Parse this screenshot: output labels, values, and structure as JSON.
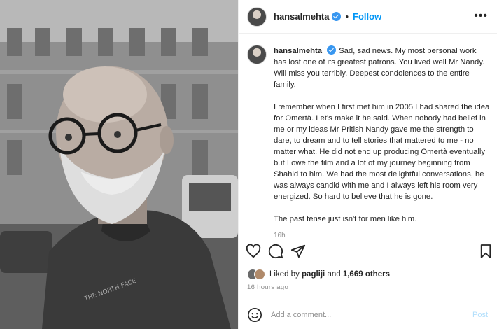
{
  "post": {
    "username": "hansalmehta",
    "dot": "•",
    "follow_label": "Follow",
    "more_label": "•••",
    "caption": {
      "username": "hansalmehta",
      "p1": "Sad, sad news. My most personal work has lost one of its greatest patrons. You lived well Mr Nandy. Will miss you terribly. Deepest condolences to the entire family.",
      "p2": "I remember when I first met him in 2005 I had shared the idea for Omertà. Let's make it he said. When nobody had belief in me or my ideas Mr Pritish Nandy gave me the strength to dare, to dream and to tell stories that mattered to me - no matter what. He did not end up producing Omertà eventually but I owe the film and a lot of my journey beginning from Shahid to him. We had the most delightful conversations, he was always candid with me and I always left his room very energized. So hard to believe that he is gone.",
      "p3": "The past tense just isn't for men like him.",
      "time": "16h"
    },
    "likes": {
      "prefix": "Liked by ",
      "user": "pagliji",
      "conjunction": " and ",
      "count": "1,669 others"
    },
    "posted_ago": "16 hours ago",
    "comment_placeholder": "Add a comment...",
    "post_button": "Post"
  },
  "icons": {
    "like": "heart-icon",
    "comment": "comment-icon",
    "share": "share-icon",
    "save": "bookmark-icon",
    "emoji": "emoji-icon"
  },
  "colors": {
    "link": "#0095f6",
    "verified": "#3897f0",
    "muted": "#8e8e8e"
  }
}
